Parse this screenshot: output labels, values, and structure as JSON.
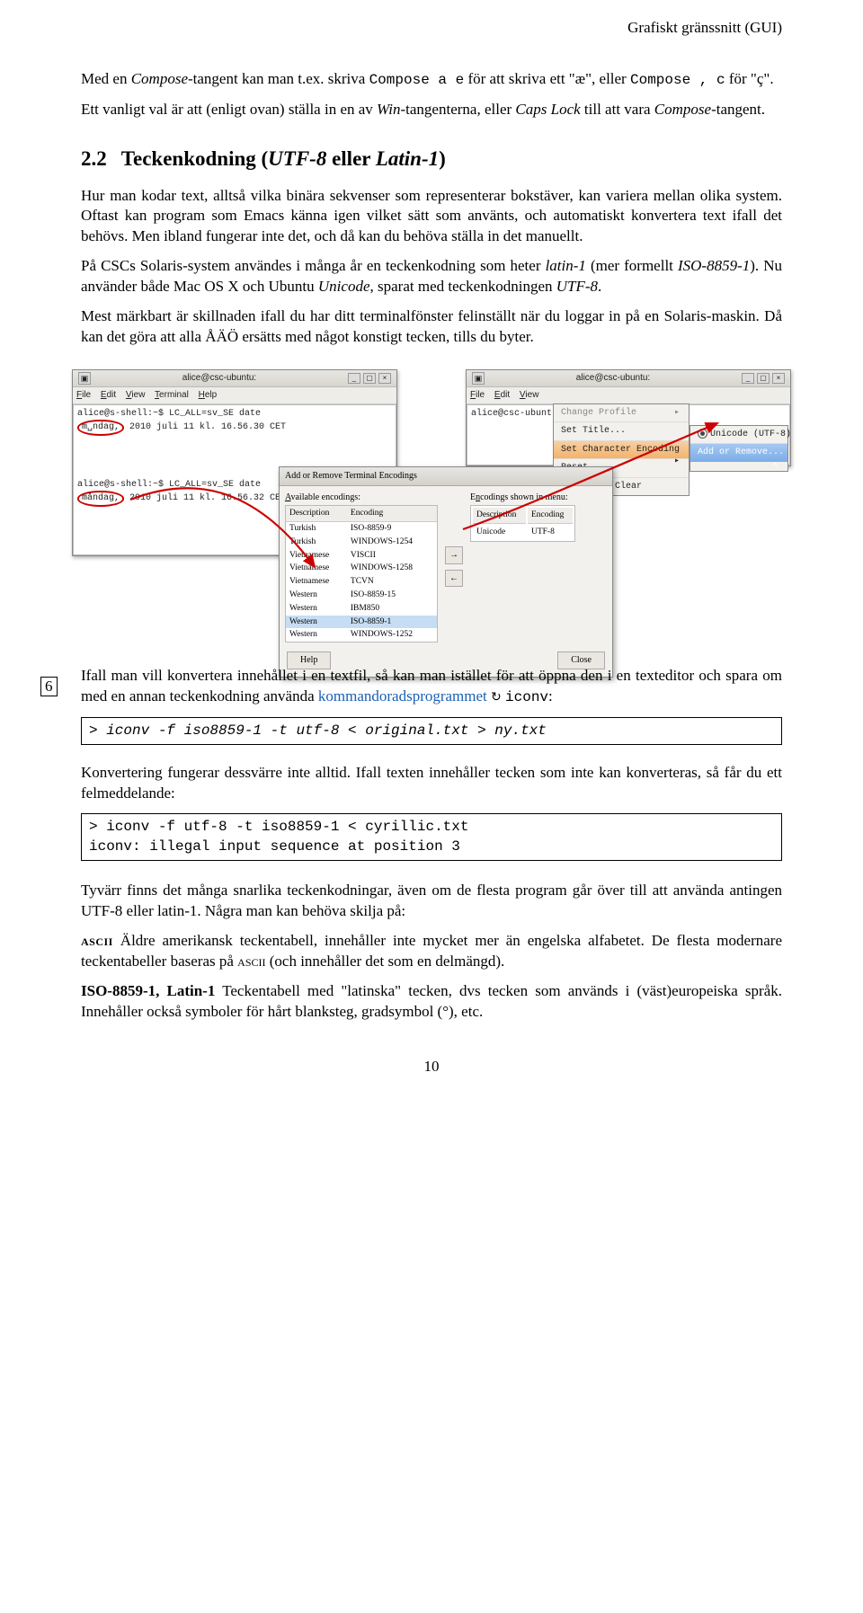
{
  "header": {
    "running_head": "Grafiskt gränssnitt (GUI)"
  },
  "intro": {
    "p1_a": "Med en ",
    "p1_b": "Compose",
    "p1_c": "-tangent kan man t.ex. skriva ",
    "p1_d": "Compose a e",
    "p1_e": " för att skriva ett \"æ\", eller ",
    "p1_f": "Compose , c",
    "p1_g": " för \"ç\".",
    "p2_a": "Ett vanligt val är att (enligt ovan) ställa in en av ",
    "p2_b": "Win",
    "p2_c": "-tangenterna, eller ",
    "p2_d": "Caps Lock",
    "p2_e": " till att vara ",
    "p2_f": "Compose",
    "p2_g": "-tangent."
  },
  "section": {
    "num": "2.2",
    "title_a": "Teckenkodning (",
    "title_b": "UTF-8",
    "title_c": " eller ",
    "title_d": "Latin-1",
    "title_e": ")",
    "p1": "Hur man kodar text, alltså vilka binära sekvenser som representerar bokstäver, kan variera mellan olika system. Oftast kan program som Emacs känna igen vilket sätt som använts, och automatiskt konvertera text ifall det behövs. Men ibland fungerar inte det, och då kan du behöva ställa in det manuellt.",
    "p2_a": "På CSCs Solaris-system användes i många år en teckenkodning som heter ",
    "p2_b": "latin-1",
    "p2_c": " (mer formellt ",
    "p2_d": "ISO-8859-1",
    "p2_e": "). Nu använder både Mac OS X och Ubuntu ",
    "p2_f": "Unicode",
    "p2_g": ", sparat med teckenkodningen ",
    "p2_h": "UTF-8",
    "p2_i": ".",
    "p3": "Mest märkbart är skillnaden ifall du har ditt terminalfönster felinställt när du loggar in på en Solaris-maskin. Då kan det göra att alla ÅÄÖ ersätts med något konstigt tecken, tills du byter."
  },
  "terminal1": {
    "title": "alice@csc-ubuntu:",
    "menu": {
      "file": "File",
      "edit": "Edit",
      "view": "View",
      "terminal": "Terminal",
      "help": "Help"
    },
    "line1": "alice@s-shell:~$ LC_ALL=sv_SE date",
    "line2a": "m␣ndag,",
    "line2b": " 2010 juli 11 kl. 16.56.30 CET",
    "line3": "alice@s-shell:~$ LC_ALL=sv_SE date",
    "line4a": "måndag,",
    "line4b": " 2010 juli 11 kl. 16.56.32 CET"
  },
  "terminal2": {
    "title": "alice@csc-ubuntu:",
    "prompt": "alice@csc-ubunt",
    "menu": {
      "change_profile": "Change Profile",
      "set_title": "Set Title...",
      "set_enc": "Set Character Encoding",
      "reset": "Reset",
      "reset_clear": "Reset and Clear"
    },
    "enc_submenu": {
      "unicode": "Unicode (UTF-8)",
      "add_remove": "Add or Remove..."
    }
  },
  "dialog": {
    "title": "Add or Remove Terminal Encodings",
    "avail_label": "Available encodings:",
    "shown_label": "Encodings shown in menu:",
    "headers": {
      "desc": "Description",
      "enc": "Encoding"
    },
    "rows": [
      {
        "d": "Turkish",
        "e": "ISO-8859-9"
      },
      {
        "d": "Turkish",
        "e": "WINDOWS-1254"
      },
      {
        "d": "Vietnamese",
        "e": "VISCII"
      },
      {
        "d": "Vietnamese",
        "e": "WINDOWS-1258"
      },
      {
        "d": "Vietnamese",
        "e": "TCVN"
      },
      {
        "d": "Western",
        "e": "ISO-8859-15"
      },
      {
        "d": "Western",
        "e": "IBM850"
      },
      {
        "d": "Western",
        "e": "ISO-8859-1"
      },
      {
        "d": "Western",
        "e": "WINDOWS-1252"
      }
    ],
    "shown_rows": [
      {
        "d": "Unicode",
        "e": "UTF-8"
      }
    ],
    "help_btn": "Help",
    "close_btn": "Close"
  },
  "margin6": "6",
  "conv": {
    "p1_a": "Ifall man vill konvertera innehållet i en textfil, så kan man istället för att öppna den i en texteditor och spara om med en annan teckenkodning använda ",
    "p1_link": "kommandoradsprogrammet",
    "p1_b": " ",
    "p1_code": "iconv",
    "p1_c": ":",
    "cmd1": "> iconv -f iso8859-1 -t utf-8 < original.txt > ny.txt",
    "p2": "Konvertering fungerar dessvärre inte alltid. Ifall texten innehåller tecken som inte kan konverteras, så får du ett felmeddelande:",
    "cmd2": "> iconv -f utf-8 -t iso8859-1 < cyrillic.txt\niconv: illegal input sequence at position 3",
    "p3": "Tyvärr finns det många snarlika teckenkodningar, även om de flesta program går över till att använda antingen UTF-8 eller latin-1. Några man kan behöva skilja på:"
  },
  "defs": {
    "ascii_term": "ascii",
    "ascii_txt_a": " Äldre amerikansk teckentabell, innehåller inte mycket mer än engelska alfabetet. De flesta modernare teckentabeller baseras på ",
    "ascii_txt_b": "ascii",
    "ascii_txt_c": " (och innehåller det som en delmängd).",
    "iso_term": "ISO-8859-1, Latin-1",
    "iso_txt": " Teckentabell med \"latinska\" tecken, dvs tecken som används i (väst)europeiska språk. Innehåller också symboler för hårt blanksteg, gradsymbol (°), etc."
  },
  "page_number": "10"
}
